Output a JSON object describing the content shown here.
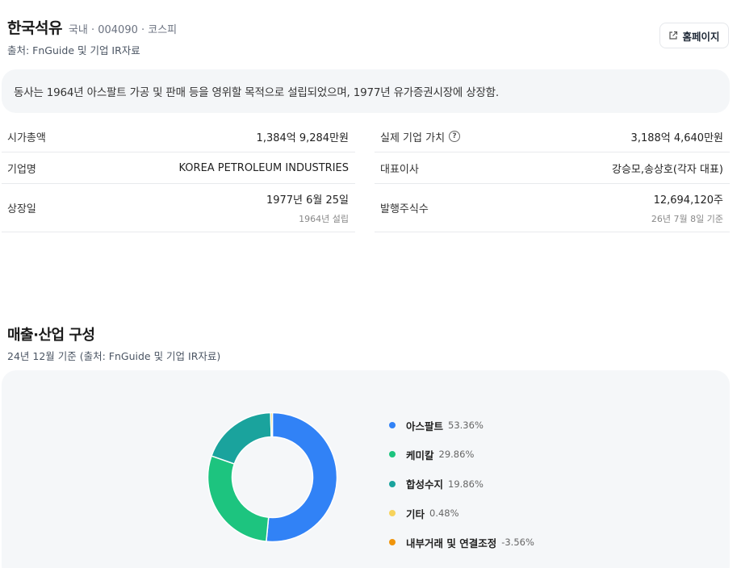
{
  "header": {
    "company_name": "한국석유",
    "meta": "국내 · 004090 · 코스피",
    "source": "출처: FnGuide 및 기업 IR자료",
    "homepage_label": "홈페이지"
  },
  "description": "동사는 1964년 아스팔트 가공 및 판매 등을 영위할 목적으로 설립되었으며, 1977년 유가증권시장에 상장함.",
  "info_left": [
    {
      "label": "시가총액",
      "value": "1,384억 9,284만원"
    },
    {
      "label": "기업명",
      "value": "KOREA PETROLEUM INDUSTRIES"
    },
    {
      "label": "상장일",
      "value": "1977년 6월 25일",
      "sub": "1964년 설립"
    }
  ],
  "info_right": [
    {
      "label": "실제 기업 가치",
      "value": "3,188억 4,640만원"
    },
    {
      "label": "대표이사",
      "value": "강승모,송상호(각자 대표)"
    },
    {
      "label": "발행주식수",
      "value": "12,694,120주",
      "sub": "26년 7월 8일 기준"
    }
  ],
  "section": {
    "title": "매출·산업 구성",
    "subtitle": "24년 12월 기준 (출처: FnGuide 및 기업 IR자료)"
  },
  "chart_data": {
    "type": "pie",
    "categories": [
      "아스팔트",
      "케미칼",
      "합성수지",
      "기타",
      "내부거래 및 연결조정"
    ],
    "values": [
      53.36,
      29.86,
      19.86,
      0.48,
      -3.56
    ],
    "labels": [
      "53.36%",
      "29.86%",
      "19.86%",
      "0.48%",
      "-3.56%"
    ],
    "colors": [
      "#3182f6",
      "#1dc47f",
      "#1aa39d",
      "#f7d35c",
      "#f0950c"
    ],
    "donut": true
  }
}
